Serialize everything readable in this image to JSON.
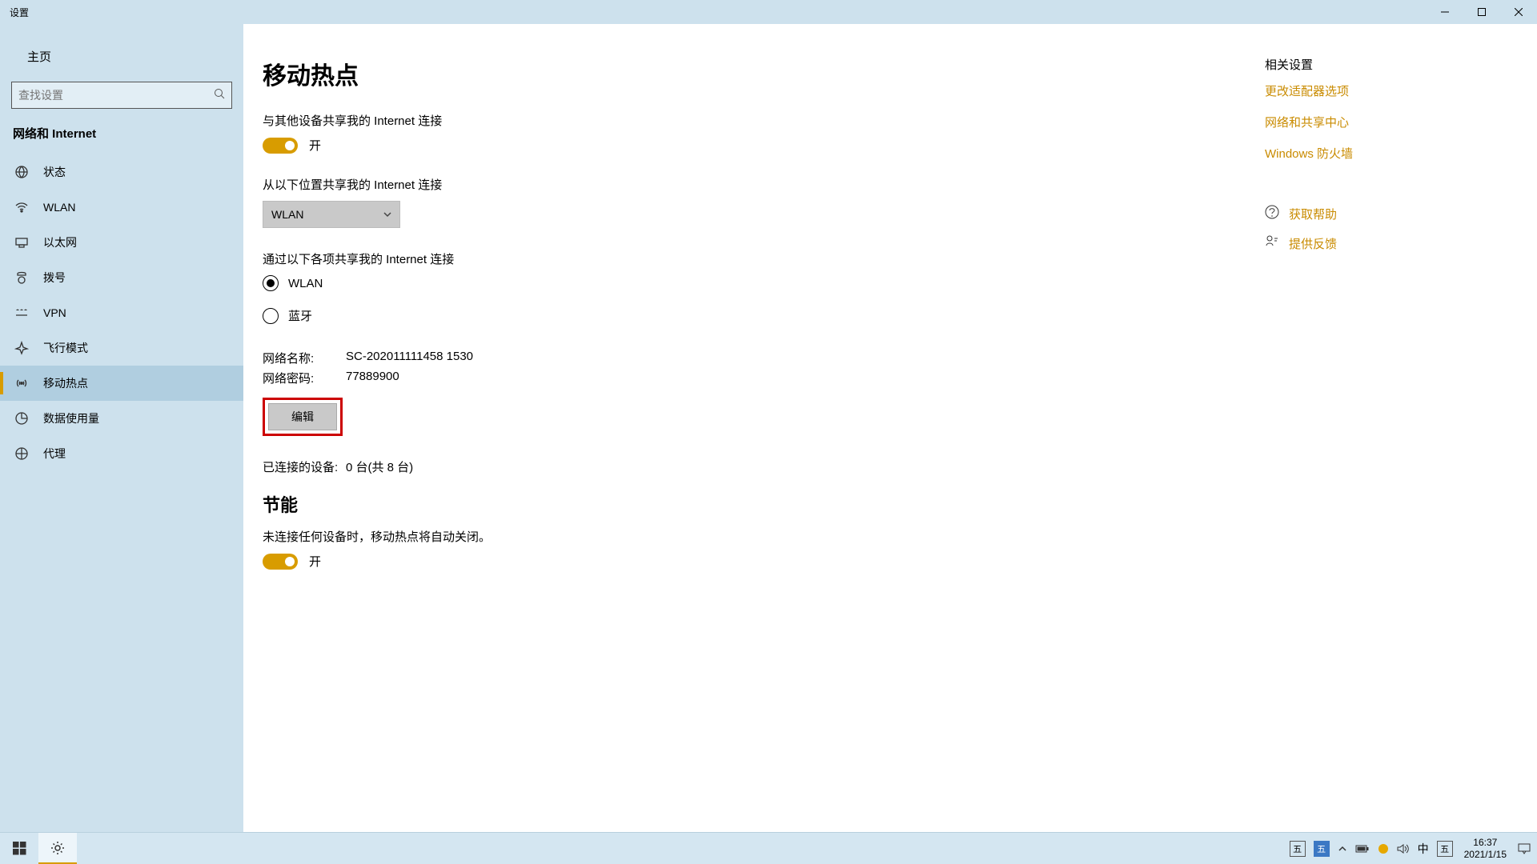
{
  "window": {
    "title": "设置"
  },
  "sidebar": {
    "home": "主页",
    "searchPlaceholder": "查找设置",
    "section": "网络和 Internet",
    "items": [
      {
        "label": "状态"
      },
      {
        "label": "WLAN"
      },
      {
        "label": "以太网"
      },
      {
        "label": "拨号"
      },
      {
        "label": "VPN"
      },
      {
        "label": "飞行模式"
      },
      {
        "label": "移动热点"
      },
      {
        "label": "数据使用量"
      },
      {
        "label": "代理"
      }
    ]
  },
  "main": {
    "title": "移动热点",
    "shareLabel": "与其他设备共享我的 Internet 连接",
    "shareToggle": "开",
    "fromLabel": "从以下位置共享我的 Internet 连接",
    "fromValue": "WLAN",
    "viaLabel": "通过以下各项共享我的 Internet 连接",
    "radio1": "WLAN",
    "radio2": "蓝牙",
    "nameKey": "网络名称:",
    "nameValue": "SC-202011111458 1530",
    "pwdKey": "网络密码:",
    "pwdValue": "77889900",
    "editBtn": "编辑",
    "connectedKey": "已连接的设备:",
    "connectedValue": "0 台(共 8 台)",
    "powerTitle": "节能",
    "powerText": "未连接任何设备时，移动热点将自动关闭。",
    "powerToggle": "开"
  },
  "aside": {
    "relatedTitle": "相关设置",
    "link1": "更改适配器选项",
    "link2": "网络和共享中心",
    "link3": "Windows 防火墙",
    "help": "获取帮助",
    "feedback": "提供反馈"
  },
  "taskbar": {
    "ime1": "五",
    "ime2": "五",
    "lang": "中",
    "ime3": "五",
    "time": "16:37",
    "date": "2021/1/15"
  }
}
